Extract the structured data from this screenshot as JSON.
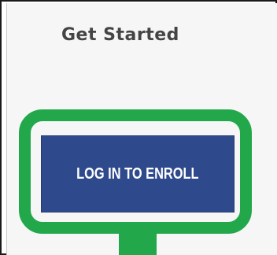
{
  "section": {
    "title": "Get Started"
  },
  "enroll_button": {
    "label": "LOG IN TO ENROLL"
  },
  "colors": {
    "button_bg": "#2f4a8c",
    "highlight": "#22a84b",
    "title_text": "#444444"
  }
}
